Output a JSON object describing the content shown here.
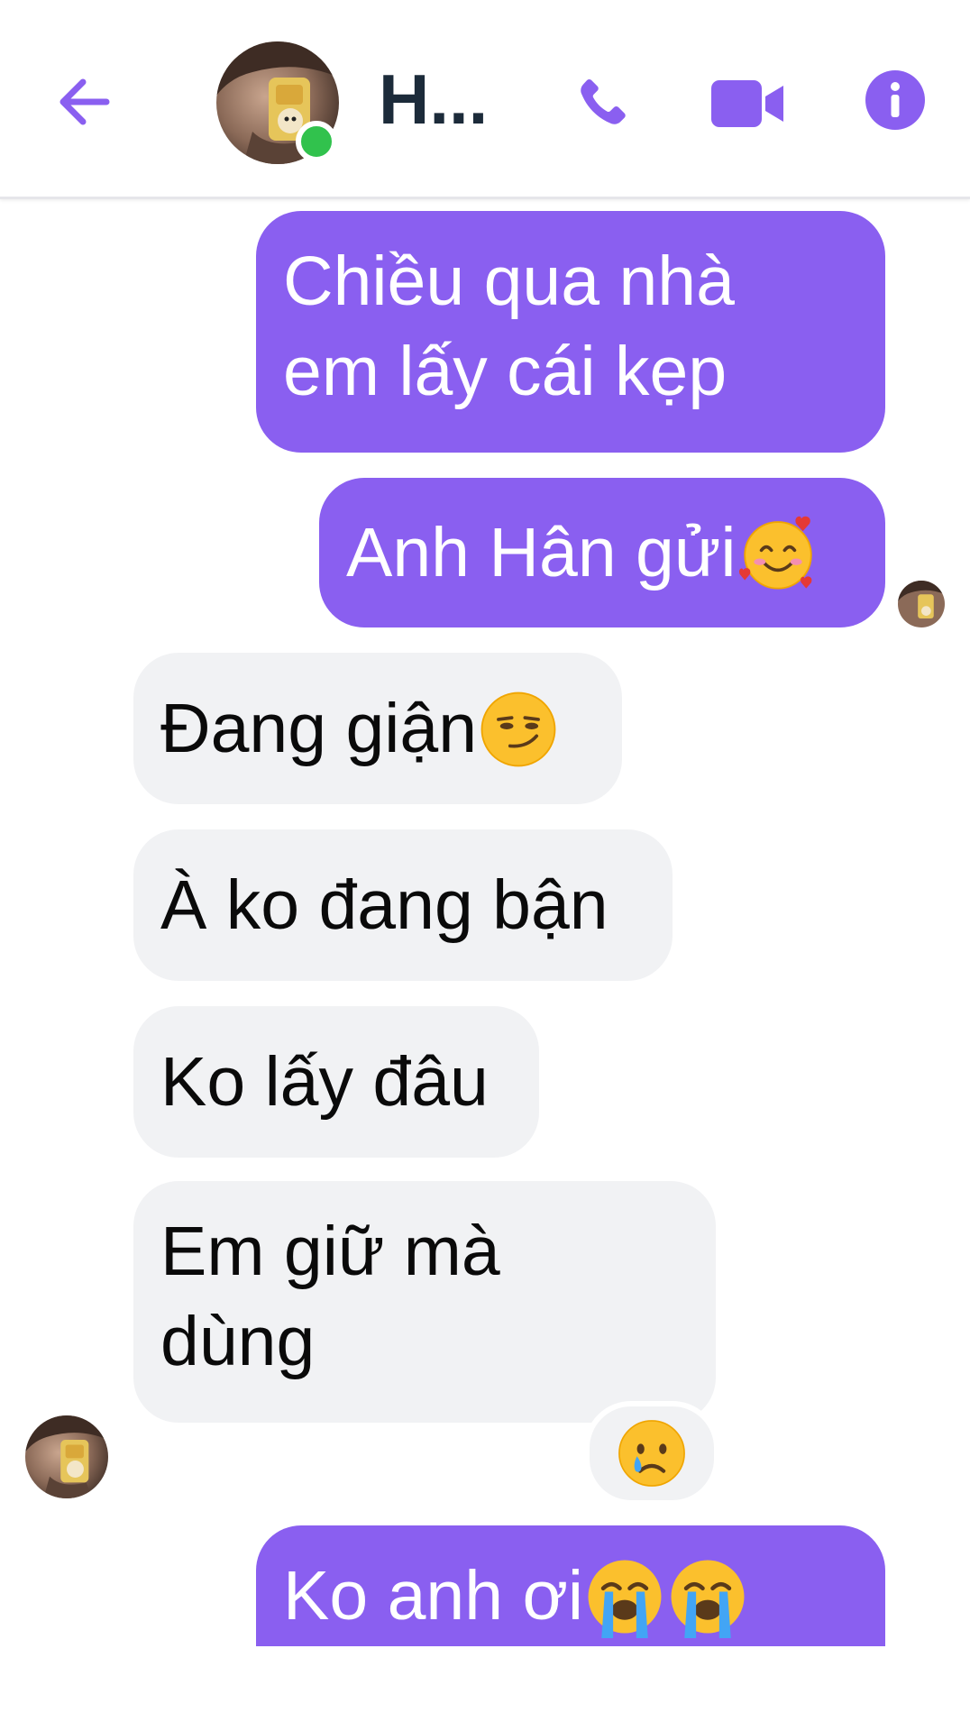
{
  "header": {
    "contact_name": "H...",
    "online": true,
    "colors": {
      "accent": "#8a5ff0",
      "online": "#31c24d",
      "name": "#1c2b3a"
    },
    "icons": [
      "back-arrow-icon",
      "phone-icon",
      "video-camera-icon",
      "info-icon"
    ]
  },
  "messages": [
    {
      "direction": "outgoing",
      "line1": "Chiều qua nhà",
      "line2": "em lấy cái kẹp"
    },
    {
      "direction": "outgoing",
      "text": "Anh Hân gửi",
      "emoji": "smiling-face-with-hearts"
    },
    {
      "direction": "incoming",
      "text": "Đang giận",
      "emoji": "smirking-face"
    },
    {
      "direction": "incoming",
      "text": "À ko đang bận"
    },
    {
      "direction": "incoming",
      "text": "Ko lấy đâu"
    },
    {
      "direction": "incoming",
      "line1": "Em giữ mà",
      "line2": "dùng",
      "reaction": "crying-face"
    },
    {
      "direction": "outgoing",
      "text": "Ko anh ơi",
      "emojis": [
        "loudly-crying-face",
        "loudly-crying-face"
      ]
    }
  ],
  "colors": {
    "outgoing_bubble": "#8a5ff0",
    "incoming_bubble": "#f1f2f4",
    "outgoing_text": "#ffffff",
    "incoming_text": "#0a0a0a"
  }
}
